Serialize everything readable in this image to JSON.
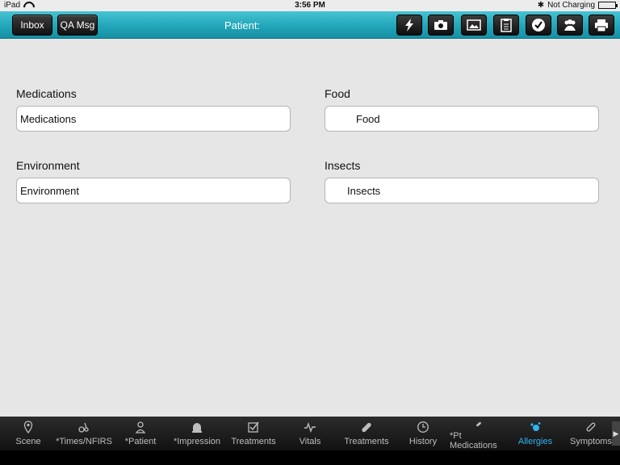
{
  "status_bar": {
    "device": "iPad",
    "time": "3:56 PM",
    "charging": "Not Charging"
  },
  "toolbar": {
    "inbox_label": "Inbox",
    "qa_msg_label": "QA Msg",
    "title": "Patient:",
    "icons": [
      "lightning-icon",
      "camera-icon",
      "gallery-icon",
      "clipboard-icon",
      "checkmark-icon",
      "group-icon",
      "printer-icon"
    ]
  },
  "form": {
    "medications": {
      "label": "Medications",
      "value": "Medications"
    },
    "food": {
      "label": "Food",
      "value": "Food"
    },
    "environment": {
      "label": "Environment",
      "value": "Environment"
    },
    "insects": {
      "label": "Insects",
      "value": "Insects"
    }
  },
  "tabs": [
    {
      "label": "Scene",
      "icon": "map-pin-icon"
    },
    {
      "label": "*Times/NFIRS",
      "icon": "wrench-icon"
    },
    {
      "label": "*Patient",
      "icon": "patient-icon"
    },
    {
      "label": "*Impression",
      "icon": "siren-icon"
    },
    {
      "label": "Treatments",
      "icon": "checkbox-icon"
    },
    {
      "label": "Vitals",
      "icon": "pulse-icon"
    },
    {
      "label": "Treatments",
      "icon": "bandage-icon"
    },
    {
      "label": "History",
      "icon": "clock-icon"
    },
    {
      "label": "*Pt Medications",
      "icon": "pill-icon"
    },
    {
      "label": "Allergies",
      "icon": "allergy-icon"
    },
    {
      "label": "Symptoms",
      "icon": "stethoscope-icon"
    }
  ],
  "active_tab": "Allergies",
  "colors": {
    "toolbar": "#22a6ba",
    "active_tab": "#2fb4f0",
    "background": "#e6e6e6"
  }
}
